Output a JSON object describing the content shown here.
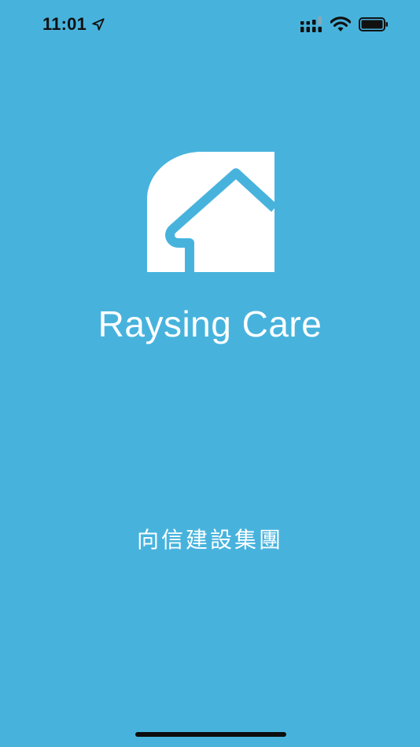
{
  "status_bar": {
    "time": "11:01",
    "icons": [
      "location-arrow-icon",
      "cellular-signal-icon",
      "wifi-icon",
      "battery-icon"
    ]
  },
  "splash": {
    "app_name": "Raysing Care",
    "company_name": "向信建設集團",
    "logo_icon": "house-logo-icon"
  },
  "colors": {
    "background": "#47b3dd",
    "foreground": "#ffffff",
    "status_text": "#111111"
  }
}
